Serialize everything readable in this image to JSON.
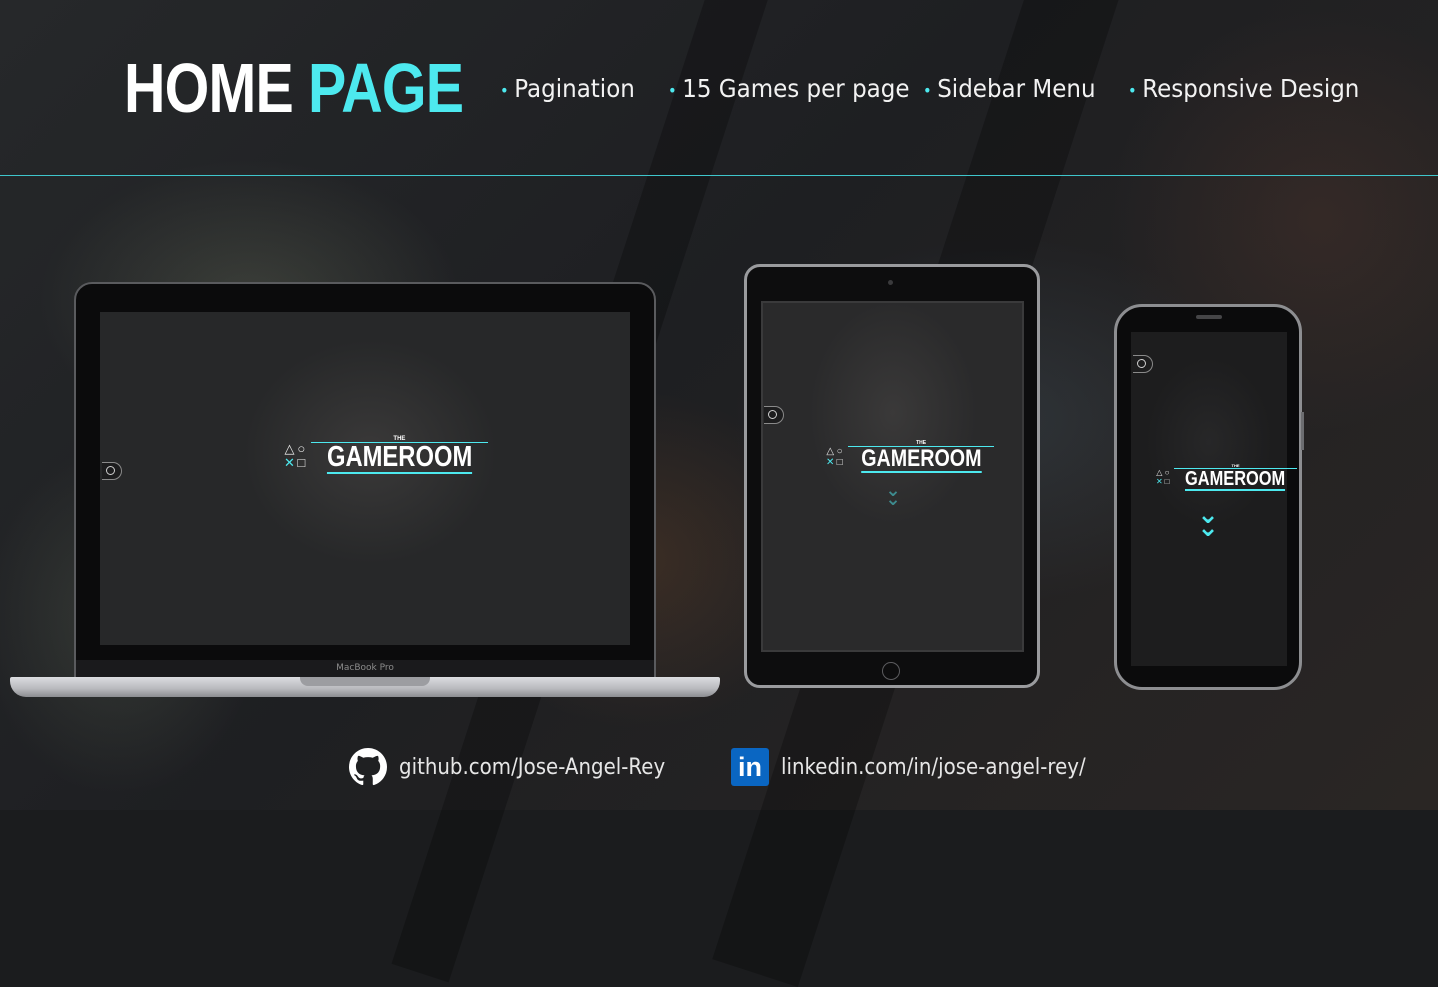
{
  "header": {
    "title_word1": "HOME",
    "title_word2": "PAGE",
    "features": [
      "Pagination",
      "15 Games per page",
      "Sidebar Menu",
      "Responsive Design"
    ]
  },
  "devices": {
    "laptop": {
      "brand": "MacBook Pro"
    },
    "logo": {
      "small": "THE",
      "name": "GAMEROOM"
    }
  },
  "footer": {
    "github": "github.com/Jose-Angel-Rey",
    "linkedin": "linkedin.com/in/jose-angel-rey/",
    "linkedin_icon_text": "in"
  },
  "colors": {
    "accent": "#4de9ef",
    "background": "#1b1c1e",
    "text": "#ffffff"
  },
  "icons": [
    "github-icon",
    "linkedin-icon",
    "menu-toggle-icon",
    "chevron-down-icon",
    "playstation-shapes-icon"
  ]
}
